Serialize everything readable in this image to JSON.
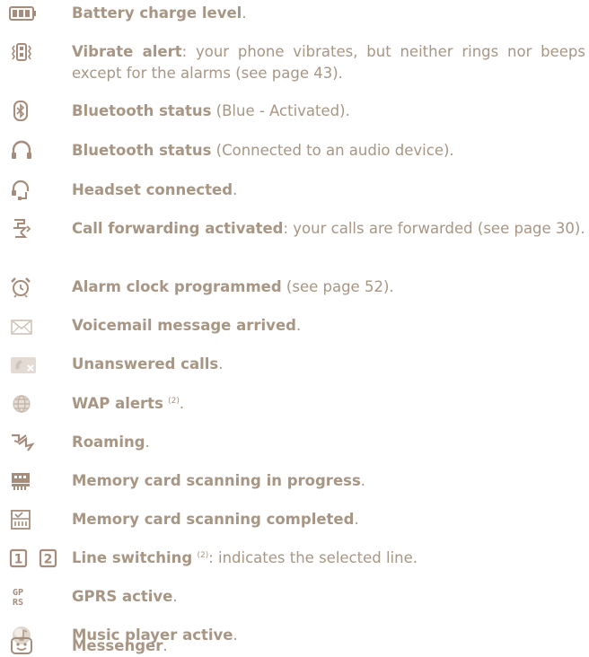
{
  "colors": {
    "text": "#a89684",
    "icon": "#a58c7b",
    "icon_light": "#cfc4b9"
  },
  "entries": [
    {
      "icon": "battery-icon",
      "bold": "Battery charge level",
      "rest": "."
    },
    {
      "icon": "vibrate-icon",
      "bold": "Vibrate alert",
      "rest": ": your phone vibrates, but neither rings nor beeps except for the alarms (see page 43)."
    },
    {
      "icon": "bluetooth-icon",
      "bold": "Bluetooth status",
      "rest": " (Blue - Activated)."
    },
    {
      "icon": "bluetooth-audio-icon",
      "bold": "Bluetooth status",
      "rest": " (Connected to an audio device)."
    },
    {
      "icon": "headset-icon",
      "bold": "Headset connected",
      "rest": "."
    },
    {
      "icon": "call-forward-icon",
      "bold": "Call forwarding activated",
      "rest": ": your calls are forwarded (see page 30)."
    },
    {
      "icon": "alarm-clock-icon",
      "bold": "Alarm clock programmed",
      "rest": " (see page 52)."
    },
    {
      "icon": "envelope-icon",
      "bold": "Voicemail message arrived",
      "rest": "."
    },
    {
      "icon": "missed-call-icon",
      "bold": "Unanswered calls",
      "rest": "."
    },
    {
      "icon": "globe-icon",
      "bold": "WAP alerts",
      "sup": "(2)",
      "rest": "."
    },
    {
      "icon": "roaming-icon",
      "bold": "Roaming",
      "rest": "."
    },
    {
      "icon": "memory-card-scanning-icon",
      "bold": "Memory card scanning in progress",
      "rest": "."
    },
    {
      "icon": "memory-card-complete-icon",
      "bold": "Memory card scanning completed",
      "rest": "."
    },
    {
      "icon": "line-switch-icon",
      "bold": "Line switching",
      "sup": "(2)",
      "rest": ": indicates the selected line.",
      "icon_text": [
        "1",
        "2"
      ]
    },
    {
      "icon": "gprs-icon",
      "bold": "GPRS active",
      "rest": ".",
      "icon_text": [
        "GP",
        "RS"
      ]
    },
    {
      "icon": "music-player-icon",
      "bold": "Music player active",
      "rest": "."
    },
    {
      "icon": "messenger-icon",
      "bold": "Messenger",
      "rest": "."
    }
  ]
}
